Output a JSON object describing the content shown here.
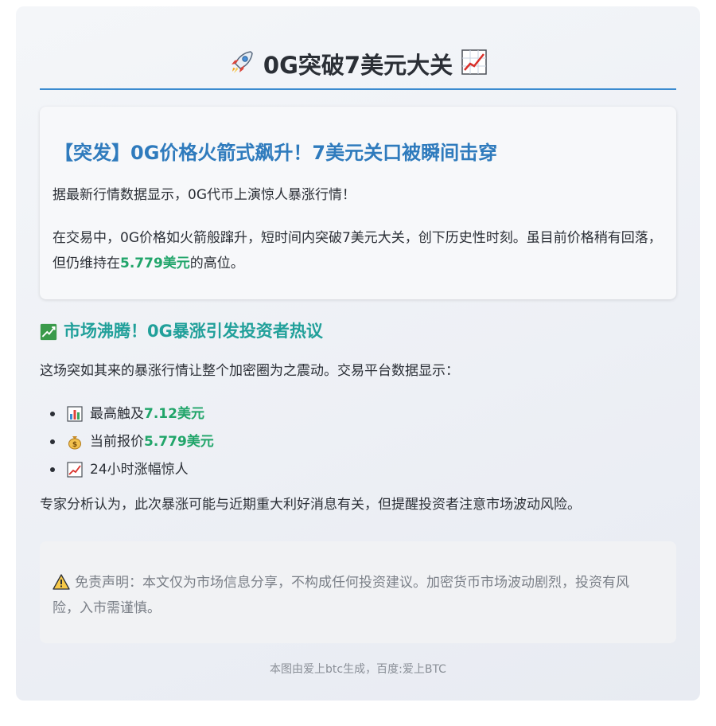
{
  "header": {
    "title": "0G突破7美元大关",
    "left_icon": "rocket-icon",
    "right_icon": "chart-increasing-icon"
  },
  "card": {
    "headline": "【突发】0G价格火箭式飙升！7美元关口被瞬间击穿",
    "paragraph1": "据最新行情数据显示，0G代币上演惊人暴涨行情！",
    "paragraph2_prefix": "在交易中，0G价格如火箭般蹿升，短时间内突破7美元大关，创下历史性时刻。虽目前价格稍有回落，但仍维持在",
    "paragraph2_highlight": "5.779美元",
    "paragraph2_suffix": "的高位。"
  },
  "section": {
    "icon": "chart-yen-icon",
    "title": "市场沸腾！0G暴涨引发投资者热议",
    "intro": "这场突如其来的暴涨行情让整个加密圈为之震动。交易平台数据显示：",
    "bullets": [
      {
        "icon": "bar-chart-icon",
        "label": "最高触及",
        "value": "7.12美元"
      },
      {
        "icon": "money-bag-icon",
        "label": "当前报价",
        "value": "5.779美元"
      },
      {
        "icon": "chart-increasing-icon",
        "label": "24小时涨幅惊人",
        "value": ""
      }
    ],
    "expert": "专家分析认为，此次暴涨可能与近期重大利好消息有关，但提醒投资者注意市场波动风险。"
  },
  "disclaimer": {
    "icon": "warning-icon",
    "text": "免责声明：本文仅为市场信息分享，不构成任何投资建议。加密货币市场波动剧烈，投资有风险，入市需谨慎。"
  },
  "footer": {
    "text": "本图由爱上btc生成，百度:爱上BTC"
  },
  "colors": {
    "accent_blue": "#2f7bbd",
    "accent_teal": "#21a09a",
    "highlight_green": "#21a56a",
    "rule_blue": "#3b8bd0"
  }
}
